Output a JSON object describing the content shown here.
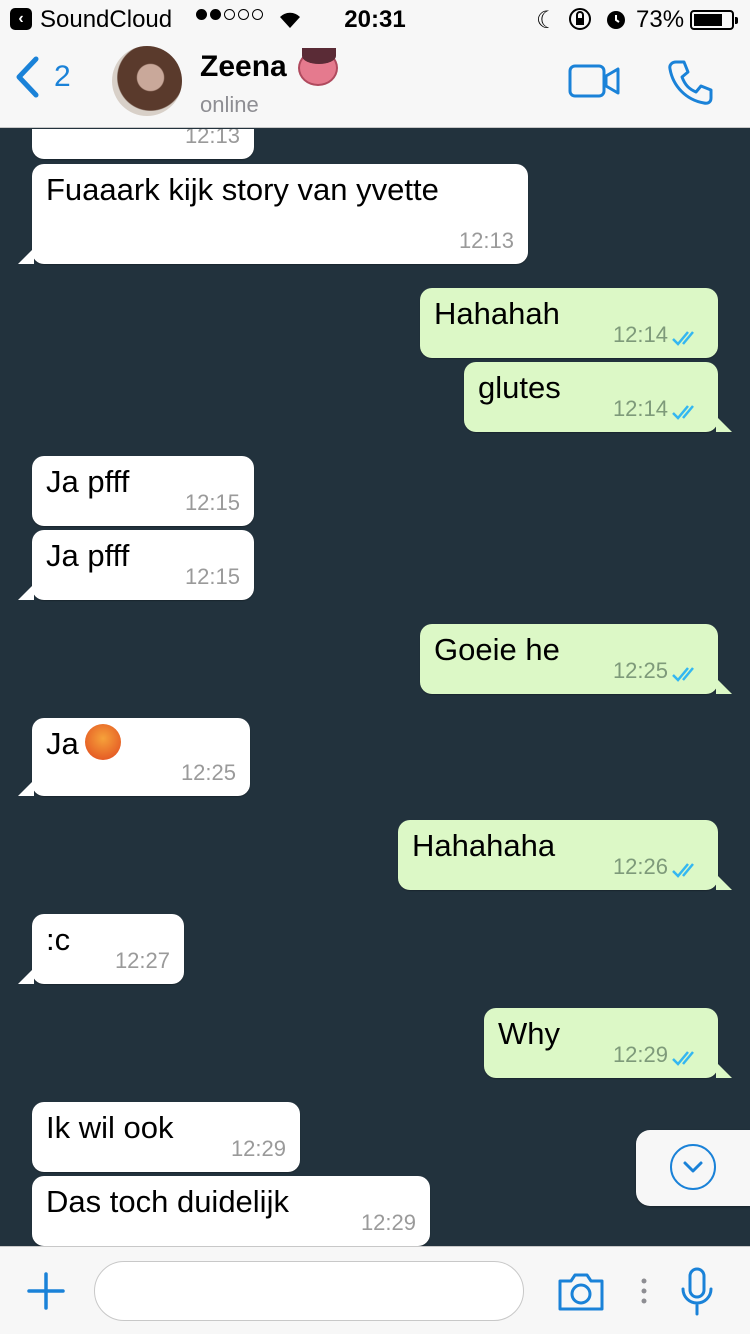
{
  "status_bar": {
    "app_name": "SoundCloud",
    "time": "20:31",
    "battery": "73%",
    "battery_level": 0.73,
    "signal_bars": 2
  },
  "header": {
    "back_count": "2",
    "contact_name": "Zeena",
    "contact_status": "online",
    "accent_color": "#1a82d8"
  },
  "messages": [
    {
      "dir": "in",
      "text": "",
      "time": "12:13"
    },
    {
      "dir": "in",
      "text": "Fuaaark kijk story van yvette",
      "time": "12:13"
    },
    {
      "dir": "out",
      "text": "Hahahah",
      "time": "12:14"
    },
    {
      "dir": "out",
      "text": "glutes",
      "time": "12:14"
    },
    {
      "dir": "in",
      "text": "Ja pfff",
      "time": "12:15"
    },
    {
      "dir": "in",
      "text": "Ja pfff",
      "time": "12:15"
    },
    {
      "dir": "out",
      "text": "Goeie he",
      "time": "12:25"
    },
    {
      "dir": "in",
      "text": "Ja",
      "time": "12:25",
      "emoji": "angry-face"
    },
    {
      "dir": "out",
      "text": "Hahahaha",
      "time": "12:26"
    },
    {
      "dir": "in",
      "text": ":c",
      "time": "12:27"
    },
    {
      "dir": "out",
      "text": "Why",
      "time": "12:29"
    },
    {
      "dir": "in",
      "text": "Ik wil ook",
      "time": "12:29"
    },
    {
      "dir": "in",
      "text": "Das toch duidelijk",
      "time": "12:29"
    }
  ],
  "input": {
    "placeholder": ""
  },
  "colors": {
    "chat_background": "#22323d",
    "incoming_bubble": "#ffffff",
    "outgoing_bubble": "#dcf8c6",
    "read_ticks": "#34b7f1"
  }
}
